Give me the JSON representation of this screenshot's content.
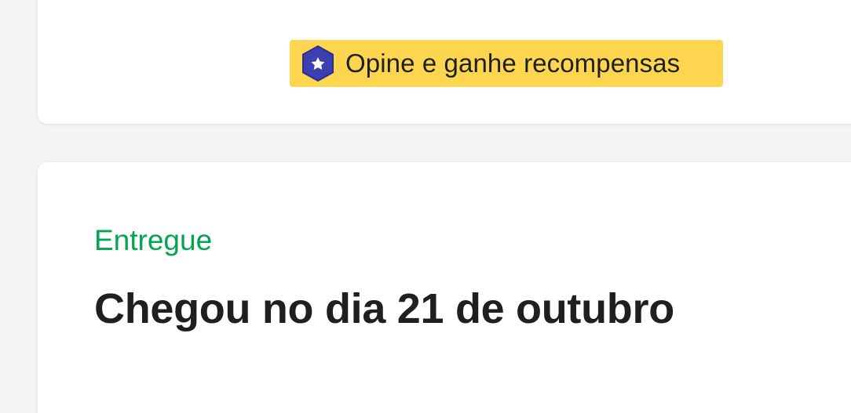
{
  "reward": {
    "label": "Opine e ganhe recompensas",
    "icon": "shield-star-icon",
    "background_color": "#fdd54f",
    "icon_color": "#3c3fb0"
  },
  "shipment": {
    "status": "Entregue",
    "status_color": "#00a650",
    "title": "Chegou no dia 21 de outubro"
  }
}
